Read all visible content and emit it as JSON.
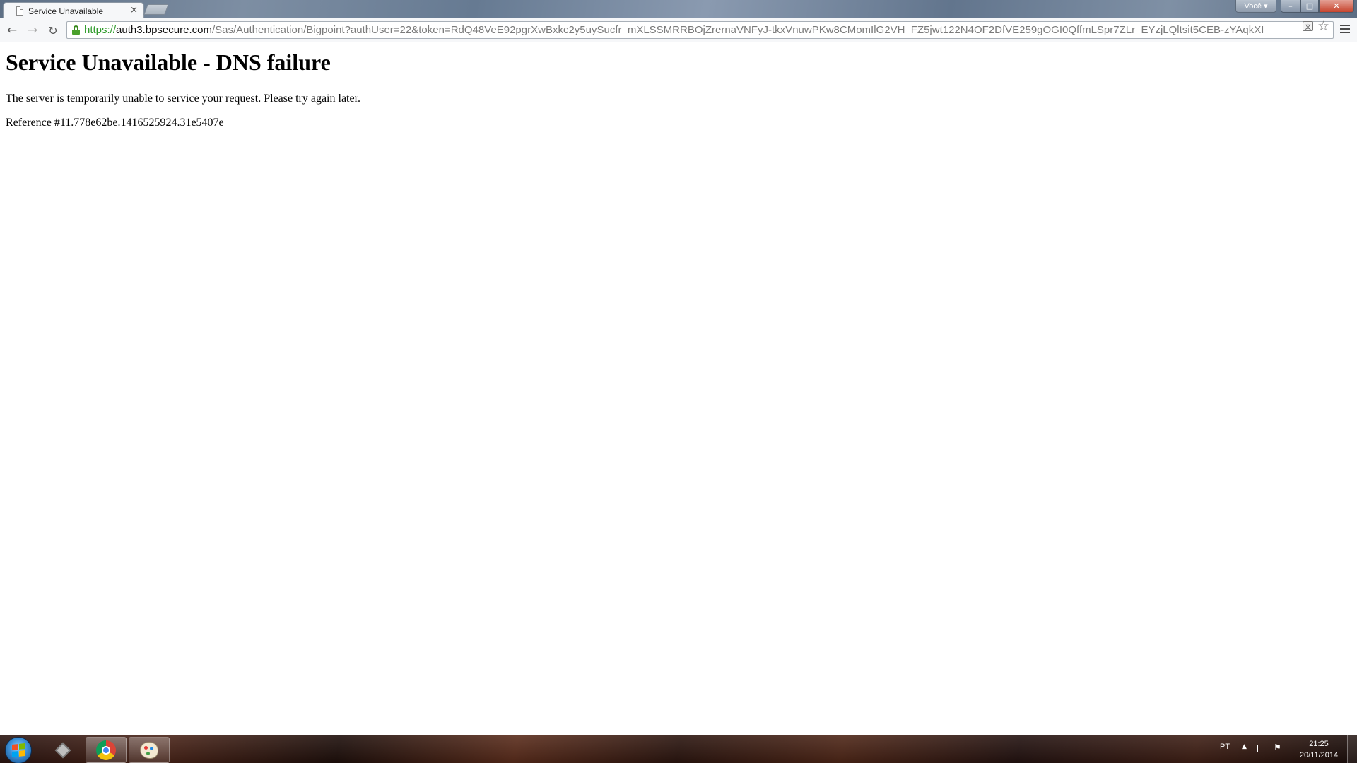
{
  "browser": {
    "tab": {
      "title": "Service Unavailable",
      "close_glyph": "×",
      "favicon": "page-icon"
    },
    "profile_label": "Você ▾",
    "window_controls": {
      "minimize": "–",
      "maximize": "□",
      "close": "✕"
    },
    "nav": {
      "back": "←",
      "forward": "→",
      "reload": "↻"
    },
    "address": {
      "scheme": "https://",
      "host": "auth3.bpsecure.com",
      "path": "/Sas/Authentication/Bigpoint?authUser=22&token=RdQ48VeE92pgrXwBxkc2y5uySucfr_mXLSSMRRBOjZrernaVNFyJ-tkxVnuwPKw8CMomIlG2VH_FZ5jwt122N4OF2DfVE259gOGI0QffmLSpr7ZLr_EYzjLQltsit5CEB-zYAqkXI",
      "secure_icon": "lock-icon"
    },
    "star_glyph": "☆",
    "translate_glyph": "文"
  },
  "page": {
    "heading": "Service Unavailable - DNS failure",
    "message": "The server is temporarily unable to service your request. Please try again later.",
    "reference": "Reference #11.778e62be.1416525924.31e5407e"
  },
  "taskbar": {
    "language": "PT",
    "tray_arrow": "▲",
    "flag_glyph": "⚑",
    "clock": {
      "time": "21:25",
      "date": "20/11/2014"
    },
    "apps": [
      "pinned-tool",
      "chrome",
      "paint"
    ]
  },
  "colors": {
    "secure_scheme": "#2e9a2a",
    "window_close": "#c7442d"
  }
}
